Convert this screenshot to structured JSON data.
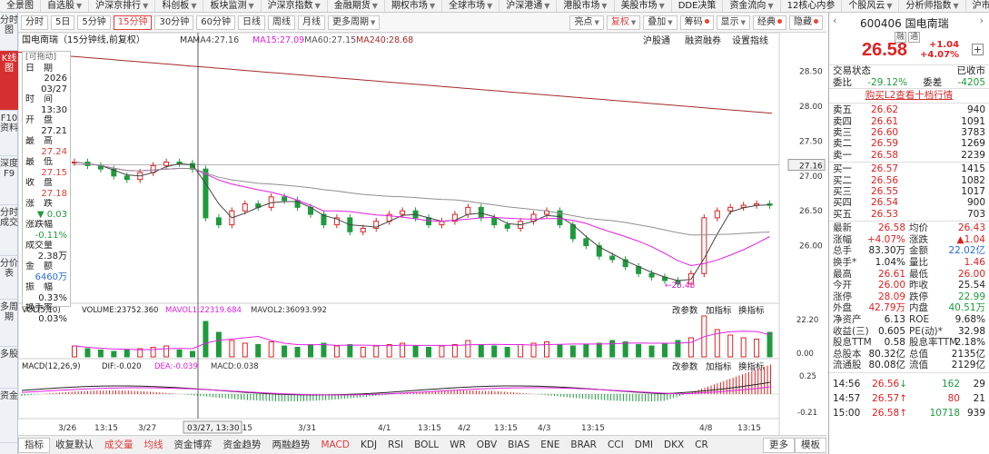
{
  "menu": [
    "全景图",
    "自选股",
    "沪深京排行",
    "科创板",
    "板块监测",
    "沪深京指数",
    "金融期货",
    "期权市场",
    "全球市场",
    "沪深港通",
    "港股市场",
    "美股市场",
    "DDE决策",
    "资金流向",
    "12核心内参",
    "个股风云",
    "分析师指数",
    "沪市导航",
    "返回"
  ],
  "menu_arrows": [
    false,
    true,
    true,
    true,
    true,
    true,
    true,
    true,
    true,
    true,
    true,
    true,
    false,
    true,
    false,
    true,
    true,
    false,
    false
  ],
  "left_tabs": [
    {
      "label": "分时图",
      "active": false
    },
    {
      "label": "K线图",
      "active": true
    },
    {
      "label": "F10资料",
      "active": false
    },
    {
      "label": "深度F9",
      "active": false
    },
    {
      "label": "分时成交",
      "active": false
    },
    {
      "label": "分价表",
      "active": false
    },
    {
      "label": "多周期",
      "active": false
    },
    {
      "label": "多股",
      "active": false
    },
    {
      "label": "资金",
      "active": false
    }
  ],
  "periods": [
    {
      "label": "分时",
      "active": false
    },
    {
      "label": "5日",
      "active": false
    },
    {
      "label": "5分钟",
      "active": false
    },
    {
      "label": "15分钟",
      "active": true
    },
    {
      "label": "30分钟",
      "active": false
    },
    {
      "label": "60分钟",
      "active": false
    },
    {
      "label": "日线",
      "active": false
    },
    {
      "label": "周线",
      "active": false
    },
    {
      "label": "月线",
      "active": false
    },
    {
      "label": "更多周期",
      "active": false,
      "arrow": true
    }
  ],
  "tools": [
    {
      "label": "亮点",
      "arrow": true
    },
    {
      "label": "复权",
      "arrow": true,
      "red": true
    },
    {
      "label": "叠加",
      "arrow": true
    },
    {
      "label": "筹码",
      "dot": true
    },
    {
      "label": "显示",
      "arrow": true
    },
    {
      "label": "经典",
      "dot": true
    },
    {
      "label": "隐藏",
      "dot": true
    }
  ],
  "chart_header": {
    "name": "国电南瑞（15分钟线,前复权）",
    "ma_label": "MA",
    "ma4": "MA4:27.16",
    "ma15": "MA15:27.09",
    "ma60": "MA60:27.15",
    "ma240": "MA240:28.68",
    "actions": [
      "沪股通",
      "融资融券",
      "设置指线"
    ]
  },
  "price_axis": [
    "28.50",
    "28.00",
    "27.50",
    "27.00",
    "26.50",
    "26.00"
  ],
  "price_marker": "27.16",
  "low_label": "←25.45",
  "vol_header": {
    "name": "VOL(5,10)",
    "vol": "VOLUME:23752.360",
    "mavol1": "MAVOL1:22319.684",
    "mavol2": "MAVOL2:36093.992",
    "actions": [
      "改参数",
      "加指标",
      "换指标"
    ]
  },
  "vol_axis": [
    "22.20",
    "0.00"
  ],
  "macd_header": {
    "name": "MACD(12,26,9)",
    "dif": "DIF:-0.020",
    "dea": "DEA:-0.039",
    "macd": "MACD:0.038",
    "actions": [
      "改参数",
      "加指标",
      "换指标"
    ]
  },
  "macd_axis": [
    "0.25",
    "-0.21"
  ],
  "x_axis": [
    "3/26",
    "13:15",
    "3/27",
    "13:15",
    "3/31",
    "4/1",
    "13:15",
    "4/2",
    "13:15",
    "4/3",
    "13:15",
    "4/8",
    "13:15"
  ],
  "x_axis_highlight": "03/27, 13:30",
  "infobox": {
    "drag": "[可拖动]",
    "rows": [
      {
        "k": "日　期",
        "v": "2026"
      },
      {
        "k": "",
        "v": "03/27"
      },
      {
        "k": "时　间",
        "v": ""
      },
      {
        "k": "",
        "v": "13:30"
      },
      {
        "k": "开　盘",
        "v": ""
      },
      {
        "k": "",
        "v": "27.21"
      },
      {
        "k": "最　高",
        "v": ""
      },
      {
        "k": "",
        "v": "27.24"
      },
      {
        "k": "最　低",
        "v": ""
      },
      {
        "k": "",
        "v": "27.15"
      },
      {
        "k": "收　盘",
        "v": ""
      },
      {
        "k": "",
        "v": "27.18"
      },
      {
        "k": "涨　跌",
        "v": ""
      },
      {
        "k": "",
        "v": "▼ 0.03"
      },
      {
        "k": "涨跌幅",
        "v": ""
      },
      {
        "k": "",
        "v": "-0.11%"
      },
      {
        "k": "成交量",
        "v": ""
      },
      {
        "k": "",
        "v": "2.38万"
      },
      {
        "k": "金　额",
        "v": ""
      },
      {
        "k": "",
        "v": "6460万"
      },
      {
        "k": "振　幅",
        "v": ""
      },
      {
        "k": "",
        "v": "0.33%"
      },
      {
        "k": "换手率",
        "v": ""
      },
      {
        "k": "",
        "v": "0.03%"
      }
    ]
  },
  "bottom_tabs": [
    {
      "label": "指标",
      "boxed": true
    },
    {
      "label": "收复默认"
    },
    {
      "label": "成交量",
      "active": true
    },
    {
      "label": "均线",
      "active": true
    },
    {
      "label": "资金博弈"
    },
    {
      "label": "资金趋势"
    },
    {
      "label": "两融趋势"
    },
    {
      "label": "MACD",
      "active": true
    },
    {
      "label": "KDJ"
    },
    {
      "label": "RSI"
    },
    {
      "label": "BOLL"
    },
    {
      "label": "WR"
    },
    {
      "label": "OBV"
    },
    {
      "label": "BIAS"
    },
    {
      "label": "ENE"
    },
    {
      "label": "BRAR"
    },
    {
      "label": "CCI"
    },
    {
      "label": "DMI"
    },
    {
      "label": "DKX"
    },
    {
      "label": "CR"
    },
    {
      "label": "更多",
      "boxed": true
    },
    {
      "label": "模板",
      "boxed": true
    }
  ],
  "stock": {
    "code": "600406",
    "name": "国电南瑞",
    "tags": [
      "融",
      "通"
    ],
    "price": "26.58",
    "change": "+1.04",
    "change_pct": "+4.07%",
    "trade_status_label": "交易状态",
    "trade_status": "已收市",
    "weibi_label": "委比",
    "weibi": "-29.12%",
    "weicha_label": "委差",
    "weicha": "-4205",
    "l2_link": "购买L2查看十档行情"
  },
  "sells": [
    {
      "k": "卖五",
      "p": "26.62",
      "v": "940"
    },
    {
      "k": "卖四",
      "p": "26.61",
      "v": "1091"
    },
    {
      "k": "卖三",
      "p": "26.60",
      "v": "3783"
    },
    {
      "k": "卖二",
      "p": "26.59",
      "v": "1269"
    },
    {
      "k": "卖一",
      "p": "26.58",
      "v": "2239"
    }
  ],
  "buys": [
    {
      "k": "买一",
      "p": "26.57",
      "v": "1415"
    },
    {
      "k": "买二",
      "p": "26.56",
      "v": "1082"
    },
    {
      "k": "买三",
      "p": "26.55",
      "v": "1017"
    },
    {
      "k": "买四",
      "p": "26.54",
      "v": "900"
    },
    {
      "k": "买五",
      "p": "26.53",
      "v": "703"
    }
  ],
  "quote": [
    {
      "k1": "最新",
      "v1": "26.58",
      "c1": "r",
      "k2": "均价",
      "v2": "26.43",
      "c2": "r"
    },
    {
      "k1": "涨幅",
      "v1": "+4.07%",
      "c1": "r",
      "k2": "涨跌",
      "v2": "▲1.04",
      "c2": "r"
    },
    {
      "k1": "总手",
      "v1": "83.30万",
      "c1": "n",
      "k2": "金额",
      "v2": "22.02亿",
      "c2": "b"
    },
    {
      "k1": "换手*",
      "v1": "1.04%",
      "c1": "n",
      "k2": "量比",
      "v2": "1.46",
      "c2": "r"
    },
    {
      "k1": "最高",
      "v1": "26.61",
      "c1": "r",
      "k2": "最低",
      "v2": "26.00",
      "c2": "r"
    },
    {
      "k1": "今开",
      "v1": "26.00",
      "c1": "r",
      "k2": "昨收",
      "v2": "25.54",
      "c2": "n"
    },
    {
      "k1": "涨停",
      "v1": "28.09",
      "c1": "r",
      "k2": "跌停",
      "v2": "22.99",
      "c2": "g"
    },
    {
      "k1": "外盘",
      "v1": "42.79万",
      "c1": "r",
      "k2": "内盘",
      "v2": "40.51万",
      "c2": "g"
    },
    {
      "k1": "净资产",
      "v1": "6.13",
      "c1": "n",
      "k2": "ROE",
      "v2": "9.68%",
      "c2": "n"
    },
    {
      "k1": "收益(三)",
      "v1": "0.605",
      "c1": "n",
      "k2": "PE(动)*",
      "v2": "32.98",
      "c2": "n"
    },
    {
      "k1": "股息TTM",
      "v1": "0.58",
      "c1": "n",
      "k2": "股息率TTM",
      "v2": "2.18%",
      "c2": "n"
    },
    {
      "k1": "总股本",
      "v1": "80.32亿",
      "c1": "n",
      "k2": "总值",
      "v2": "2135亿",
      "c2": "n"
    },
    {
      "k1": "流通股",
      "v1": "80.08亿",
      "c1": "n",
      "k2": "流值",
      "v2": "2129亿",
      "c2": "n"
    }
  ],
  "ticks": [
    {
      "t": "14:56",
      "p": "26.56",
      "dir": "↓",
      "v": "162",
      "c": "g",
      "n": "29"
    },
    {
      "t": "14:57",
      "p": "26.57",
      "dir": "↑",
      "v": "80",
      "c": "r",
      "n": "21"
    },
    {
      "t": "15:00",
      "p": "26.58",
      "dir": "↑",
      "v": "10718",
      "c": "g",
      "n": "939"
    }
  ],
  "colors": {
    "up": "#e02020",
    "down": "#1f9a3d",
    "ma4": "#444444",
    "ma15": "#e020e0",
    "ma60": "#909090",
    "ma240": "#a52a2a",
    "accent": "#e23b3b"
  }
}
